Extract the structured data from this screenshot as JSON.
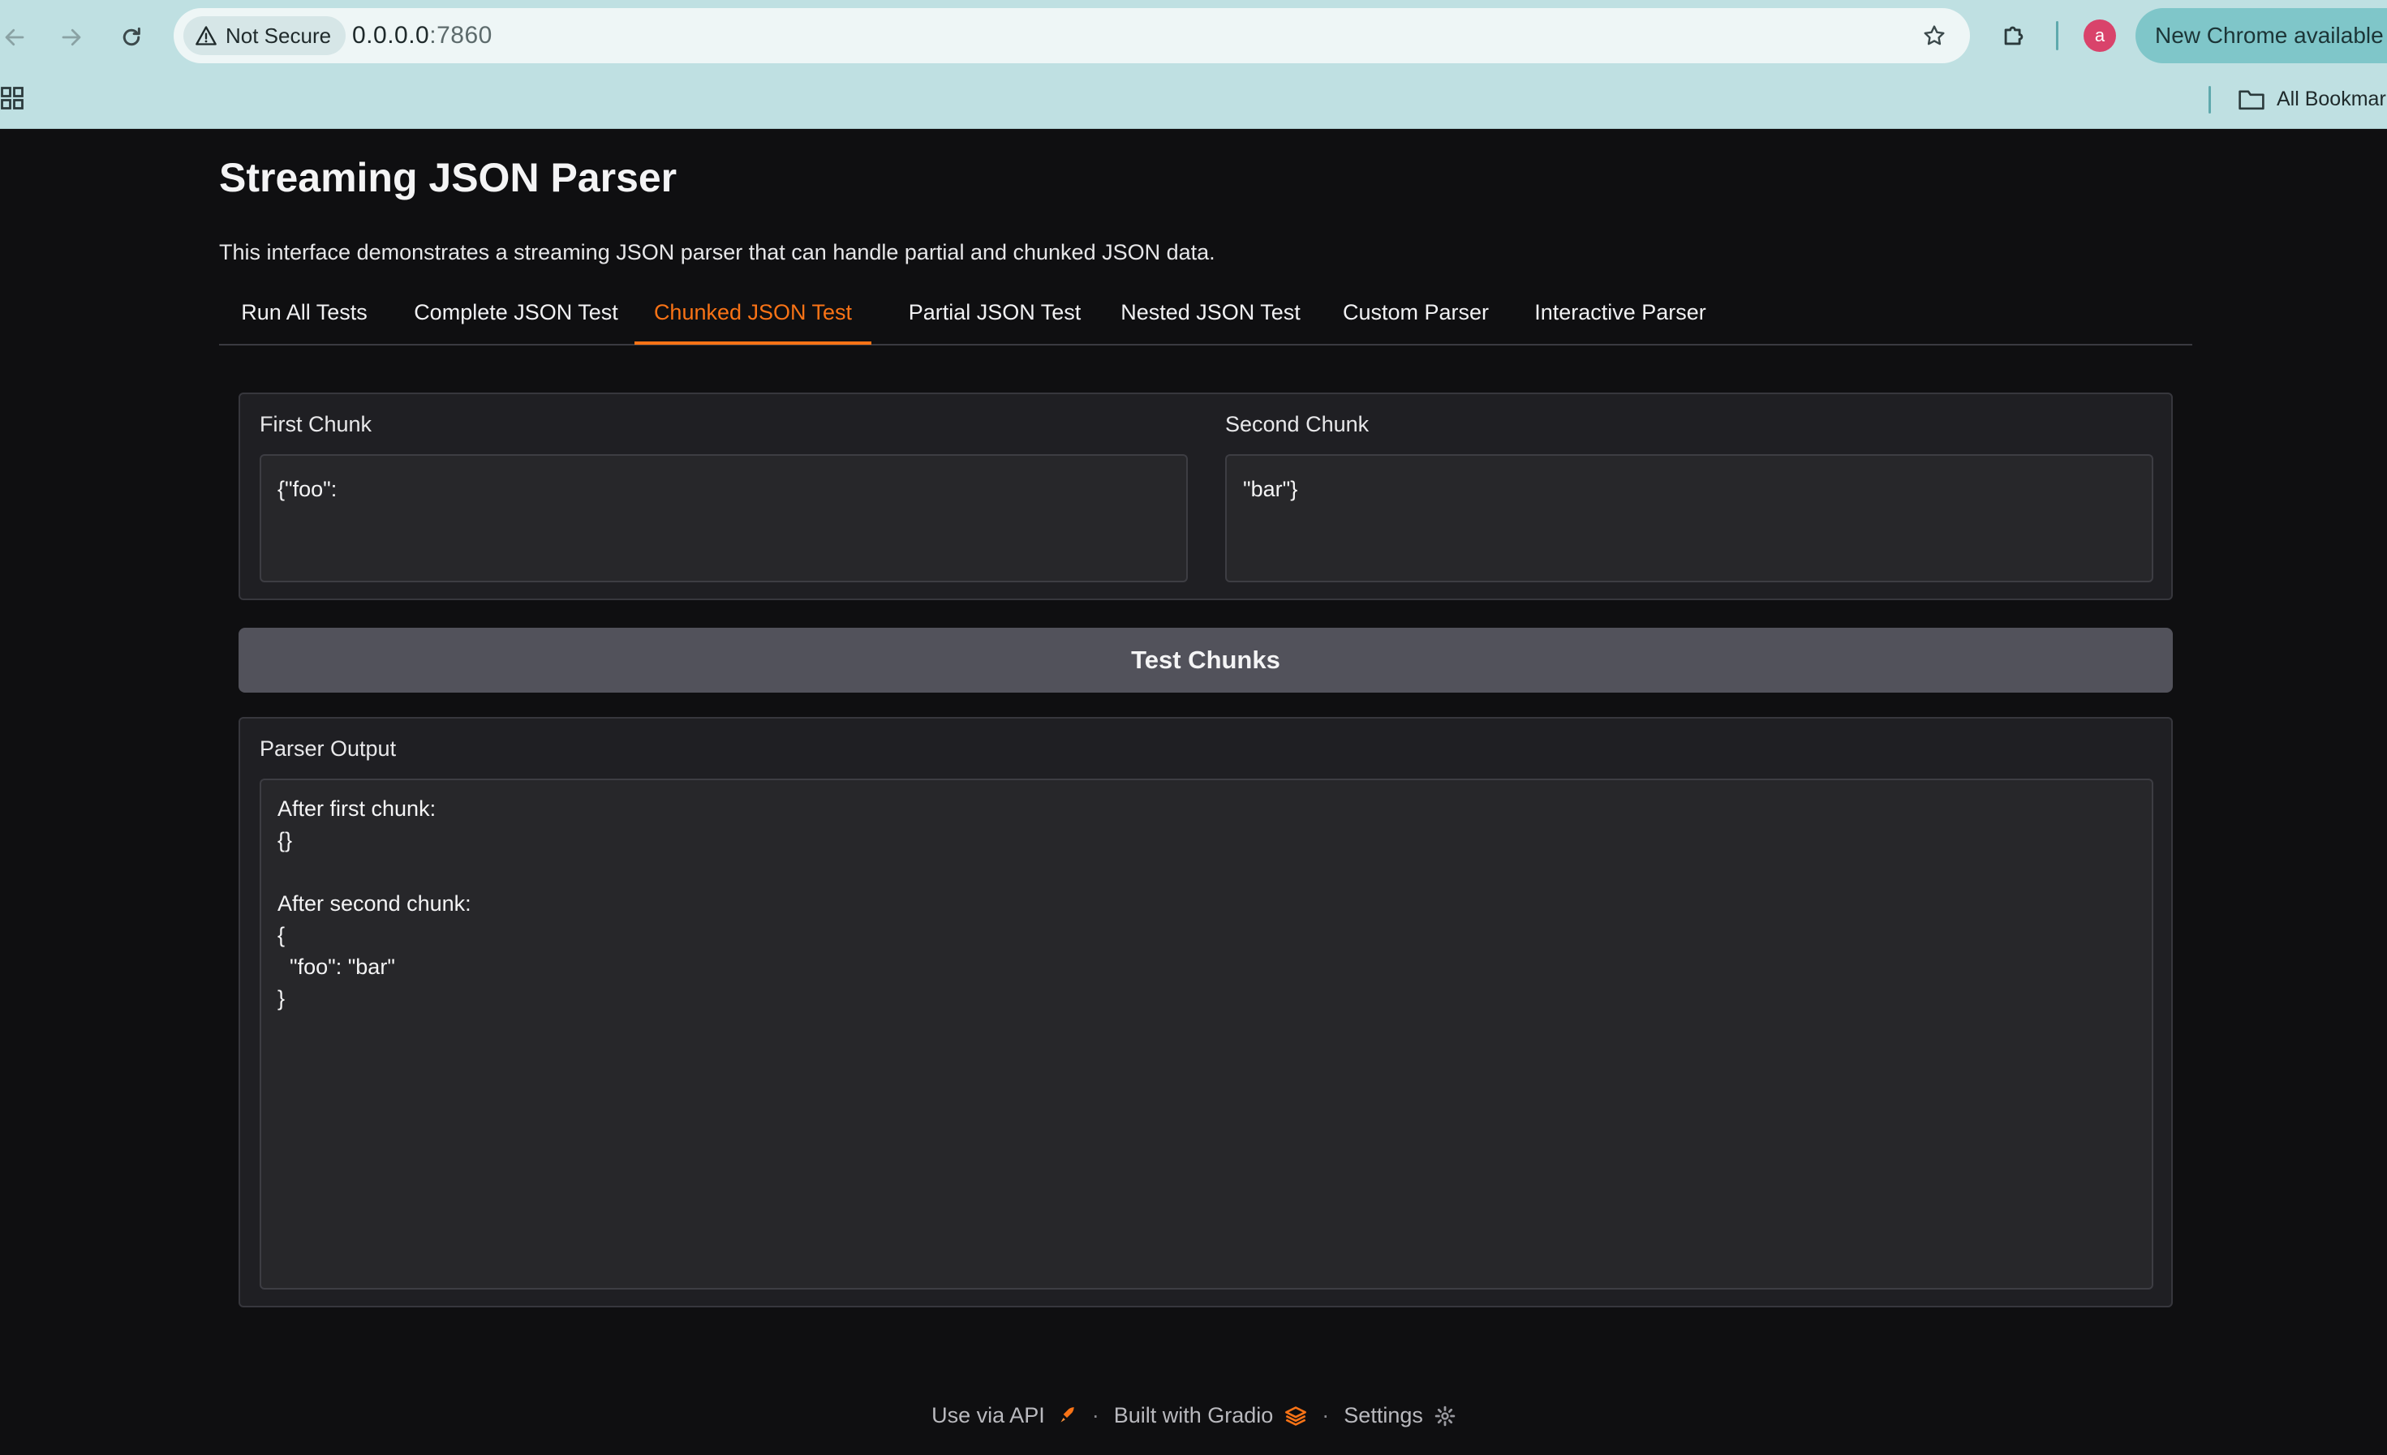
{
  "browser": {
    "security_label": "Not Secure",
    "url_host": "0.0.0.0",
    "url_port": ":7860",
    "avatar_letter": "a",
    "update_label": "New Chrome available",
    "bookmarks_label": "All Bookmarks"
  },
  "app": {
    "title": "Streaming JSON Parser",
    "description": "This interface demonstrates a streaming JSON parser that can handle partial and chunked JSON data.",
    "tabs": [
      {
        "label": "Run All Tests"
      },
      {
        "label": "Complete JSON Test"
      },
      {
        "label": "Chunked JSON Test"
      },
      {
        "label": "Partial JSON Test"
      },
      {
        "label": "Nested JSON Test"
      },
      {
        "label": "Custom Parser"
      },
      {
        "label": "Interactive Parser"
      }
    ],
    "active_tab": "Chunked JSON Test",
    "first_chunk": {
      "label": "First Chunk",
      "value": "{\"foo\":"
    },
    "second_chunk": {
      "label": "Second Chunk",
      "value": "\"bar\"}"
    },
    "test_button": "Test Chunks",
    "output": {
      "label": "Parser Output",
      "value": "After first chunk:\n{}\n\nAfter second chunk:\n{\n  \"foo\": \"bar\"\n}"
    }
  },
  "footer": {
    "api_label": "Use via API",
    "gradio_label": "Built with Gradio",
    "settings_label": "Settings",
    "separator": "·"
  },
  "colors": {
    "accent": "#f97316",
    "background": "#0f0f11",
    "panel": "#1f1f23"
  }
}
